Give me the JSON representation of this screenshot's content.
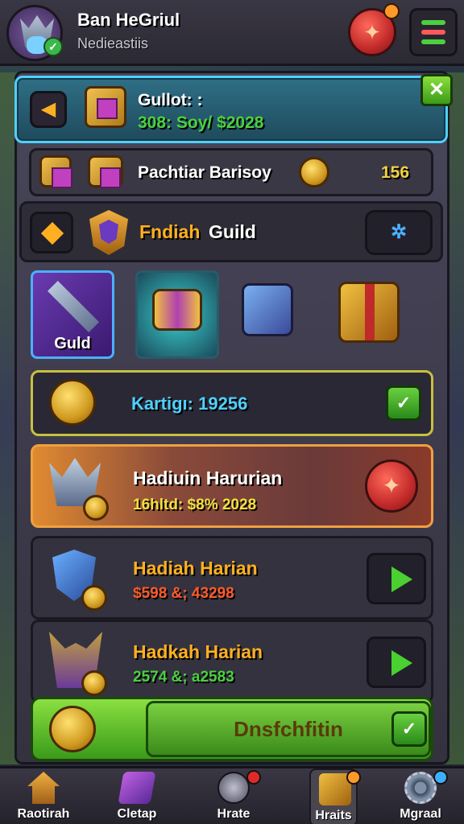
{
  "header": {
    "player_name": "Ban HeGriul",
    "player_sub": "Nedieastiis",
    "coin_glyph": "✦"
  },
  "top_card": {
    "title": "Gullot: :",
    "value": "308: Soy/ $2028"
  },
  "row2": {
    "label": "Pachtiar Barisoy",
    "value": "156"
  },
  "guild_row": {
    "label": "Fndiah",
    "label2": "Guild",
    "button_glyph": "✲"
  },
  "tiles": {
    "tile1_label": "Guld"
  },
  "currency_row": {
    "label": "Kartiɡı:",
    "value": "19256"
  },
  "rewards": [
    {
      "title": "Hadiuin Harurian",
      "value": "16hltd: $8% 2028",
      "value_color": "#f0e040"
    },
    {
      "title": "Hadiah Harian",
      "value": "$598 &; 43298",
      "value_color": "#ff5a2a"
    },
    {
      "title": "Hadkah Harian",
      "value": "2574 &; a2583",
      "value_color": "#4ad040"
    }
  ],
  "bottom_action": {
    "label": "Dnsfchfitin"
  },
  "nav": [
    {
      "label": "Raotirah"
    },
    {
      "label": "Cletap"
    },
    {
      "label": "Hrate"
    },
    {
      "label": "Hraits"
    },
    {
      "label": "Mgraal"
    }
  ],
  "colors": {
    "accent_gold": "#f0d040",
    "accent_green": "#4ad040",
    "accent_cyan": "#4fd0ff"
  }
}
